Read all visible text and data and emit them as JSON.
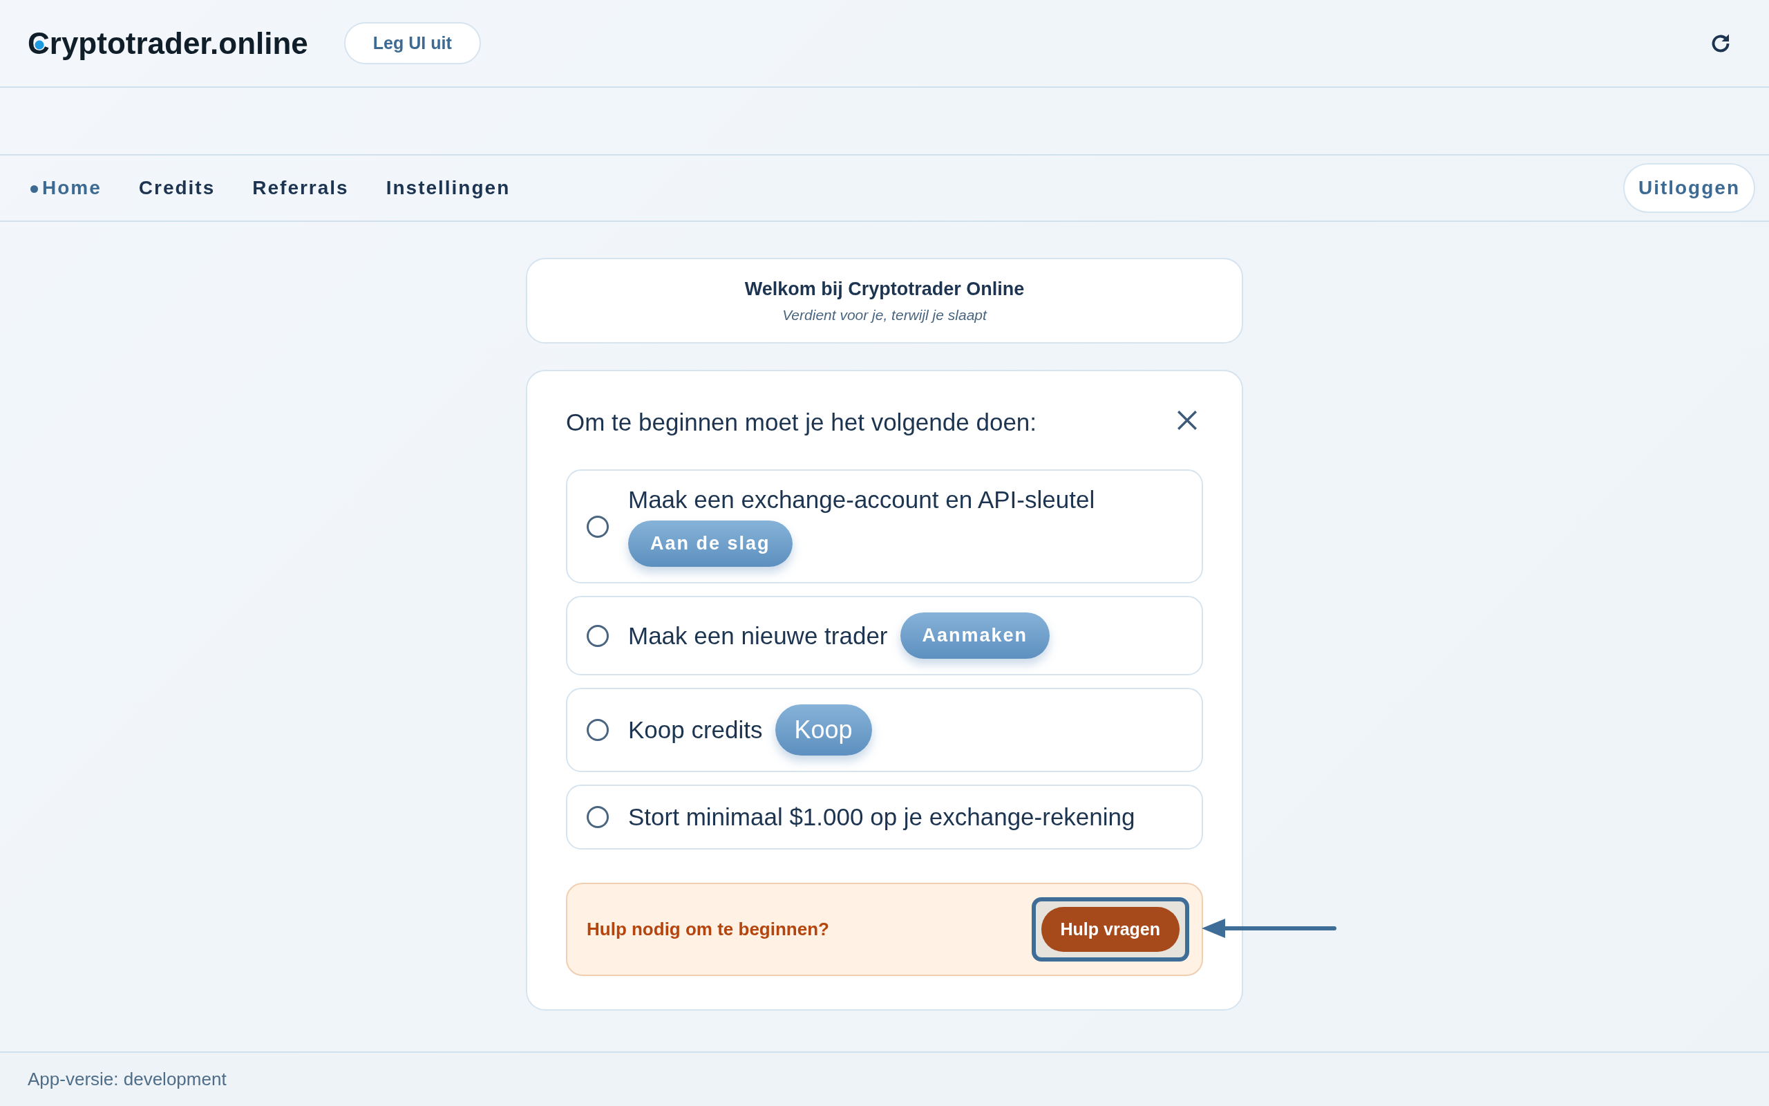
{
  "header": {
    "logo": "Cryptotrader.online",
    "layout_button": "Leg UI uit"
  },
  "nav": {
    "items": [
      {
        "label": "Home",
        "selected": true
      },
      {
        "label": "Credits",
        "selected": false
      },
      {
        "label": "Referrals",
        "selected": false
      },
      {
        "label": "Instellingen",
        "selected": false
      }
    ],
    "logout": "Uitloggen"
  },
  "welcome": {
    "title": "Welkom bij Cryptotrader Online",
    "subtitle": "Verdient voor je, terwijl je slaapt"
  },
  "checklist": {
    "title": "Om te beginnen moet je het volgende doen:",
    "items": [
      {
        "kind": "action",
        "label": "Maak een exchange-account en API-sleutel",
        "checked": false,
        "action": "Aan de slag"
      },
      {
        "kind": "action",
        "label": "Maak een nieuwe trader",
        "checked": false,
        "action": "Aanmaken"
      },
      {
        "kind": "large-action",
        "label": "Koop credits",
        "checked": false,
        "action": "Koop"
      },
      {
        "kind": "plain",
        "label": "Stort minimaal $1.000 op je exchange-rekening",
        "checked": false
      }
    ]
  },
  "help": {
    "text": "Hulp nodig om te beginnen?",
    "button": "Hulp vragen",
    "highlighted": true
  },
  "footer": {
    "version": "App-versie: development"
  }
}
